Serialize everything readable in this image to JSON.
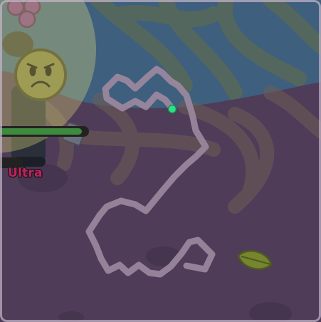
{
  "mob": {
    "rarity_label": "Ultra",
    "rarity_color": "#c22160",
    "health_fraction": 0.95
  },
  "player": {
    "health_fraction": 0.35
  },
  "colors": {
    "ground": "#4f3c58",
    "water": "#3e5f7e",
    "tree_canopy": "#6a6a3c",
    "path": "#9d8aa0",
    "health_fill": "#3e8a3e",
    "health_back": "#222222",
    "portal_dot": "#2fe08a",
    "leaf": "#76852f",
    "mob_face": "#7b7a44",
    "overlay": "#e9e37a"
  },
  "icons": {
    "mob": "sad-face-mob-icon",
    "leaf": "leaf-drop-icon",
    "grapes": "grapes-icon",
    "portal": "portal-dot-icon"
  }
}
